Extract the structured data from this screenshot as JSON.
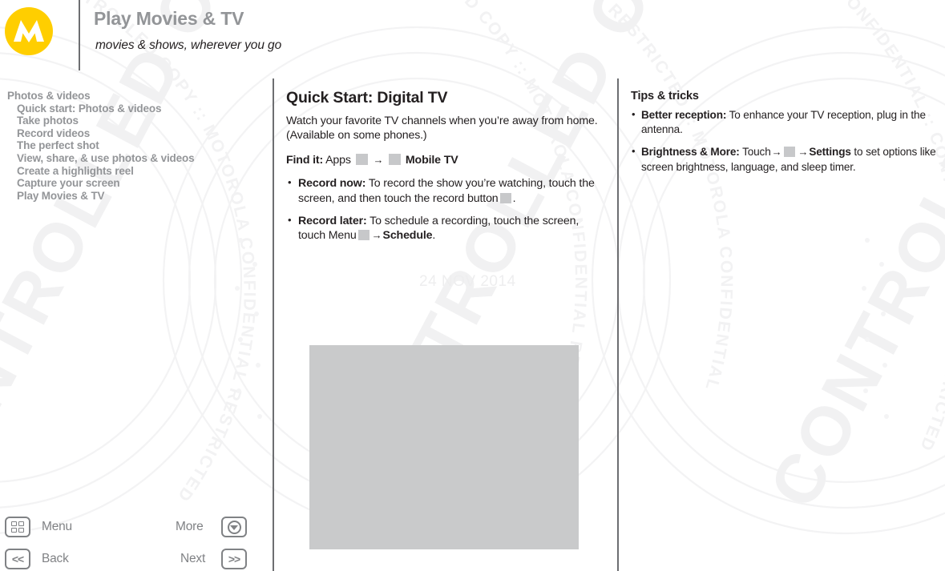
{
  "header": {
    "logo_name": "motorola-logo",
    "title": "Play Movies & TV",
    "subtitle": "movies & shows, wherever you go",
    "brand_yellow": "#FFCE00",
    "title_color": "#939598"
  },
  "sidebar": {
    "items": [
      {
        "label": "Photos & videos",
        "level": 1,
        "current": false
      },
      {
        "label": "Quick start: Photos & videos",
        "level": 2,
        "current": false
      },
      {
        "label": "Take photos",
        "level": 2,
        "current": false
      },
      {
        "label": "Record videos",
        "level": 2,
        "current": false
      },
      {
        "label": "The perfect shot",
        "level": 2,
        "current": false
      },
      {
        "label": "View, share, & use photos & videos",
        "level": 2,
        "current": false
      },
      {
        "label": "Create a highlights reel",
        "level": 2,
        "current": false
      },
      {
        "label": "Capture your screen",
        "level": 2,
        "current": false
      },
      {
        "label": "Play Movies & TV",
        "level": 2,
        "current": true
      }
    ]
  },
  "main": {
    "title": "Quick Start: Digital TV",
    "intro": "Watch your favorite TV channels when you’re away from home. (Available on some phones.)",
    "find_it": {
      "label": "Find it:",
      "step1": "Apps",
      "arrow": "→",
      "target": "Mobile TV"
    },
    "bullets": [
      {
        "label": "Record now:",
        "text_before": "To record the show you’re watching, touch the screen, and then touch the record button",
        "text_after": "."
      },
      {
        "label": "Record later:",
        "text_before": "To schedule a recording, touch the screen, touch Menu",
        "arrow": "→",
        "bold_target": "Schedule",
        "text_after": "."
      }
    ],
    "media_placeholder": "digital-tv-screenshot",
    "date_stamp": "24 NOV 2014"
  },
  "tips": {
    "title": "Tips & tricks",
    "bullets": [
      {
        "label": "Better reception:",
        "text": "To enhance your TV reception, plug in the antenna."
      },
      {
        "label": "Brightness & More:",
        "text_before": "Touch",
        "arrow1": "→",
        "arrow2": "→",
        "bold_target": "Settings",
        "text_after": "to set options like screen brightness, language, and sleep timer."
      }
    ]
  },
  "footer": {
    "menu_label": "Menu",
    "back_label": "Back",
    "more_label": "More",
    "next_label": "Next",
    "back_glyph": "<<",
    "next_glyph": ">>"
  },
  "watermark": {
    "text": "MOTOROLA CONFIDENTIAL RESTRICTED :: CONTROLLED COPY"
  }
}
